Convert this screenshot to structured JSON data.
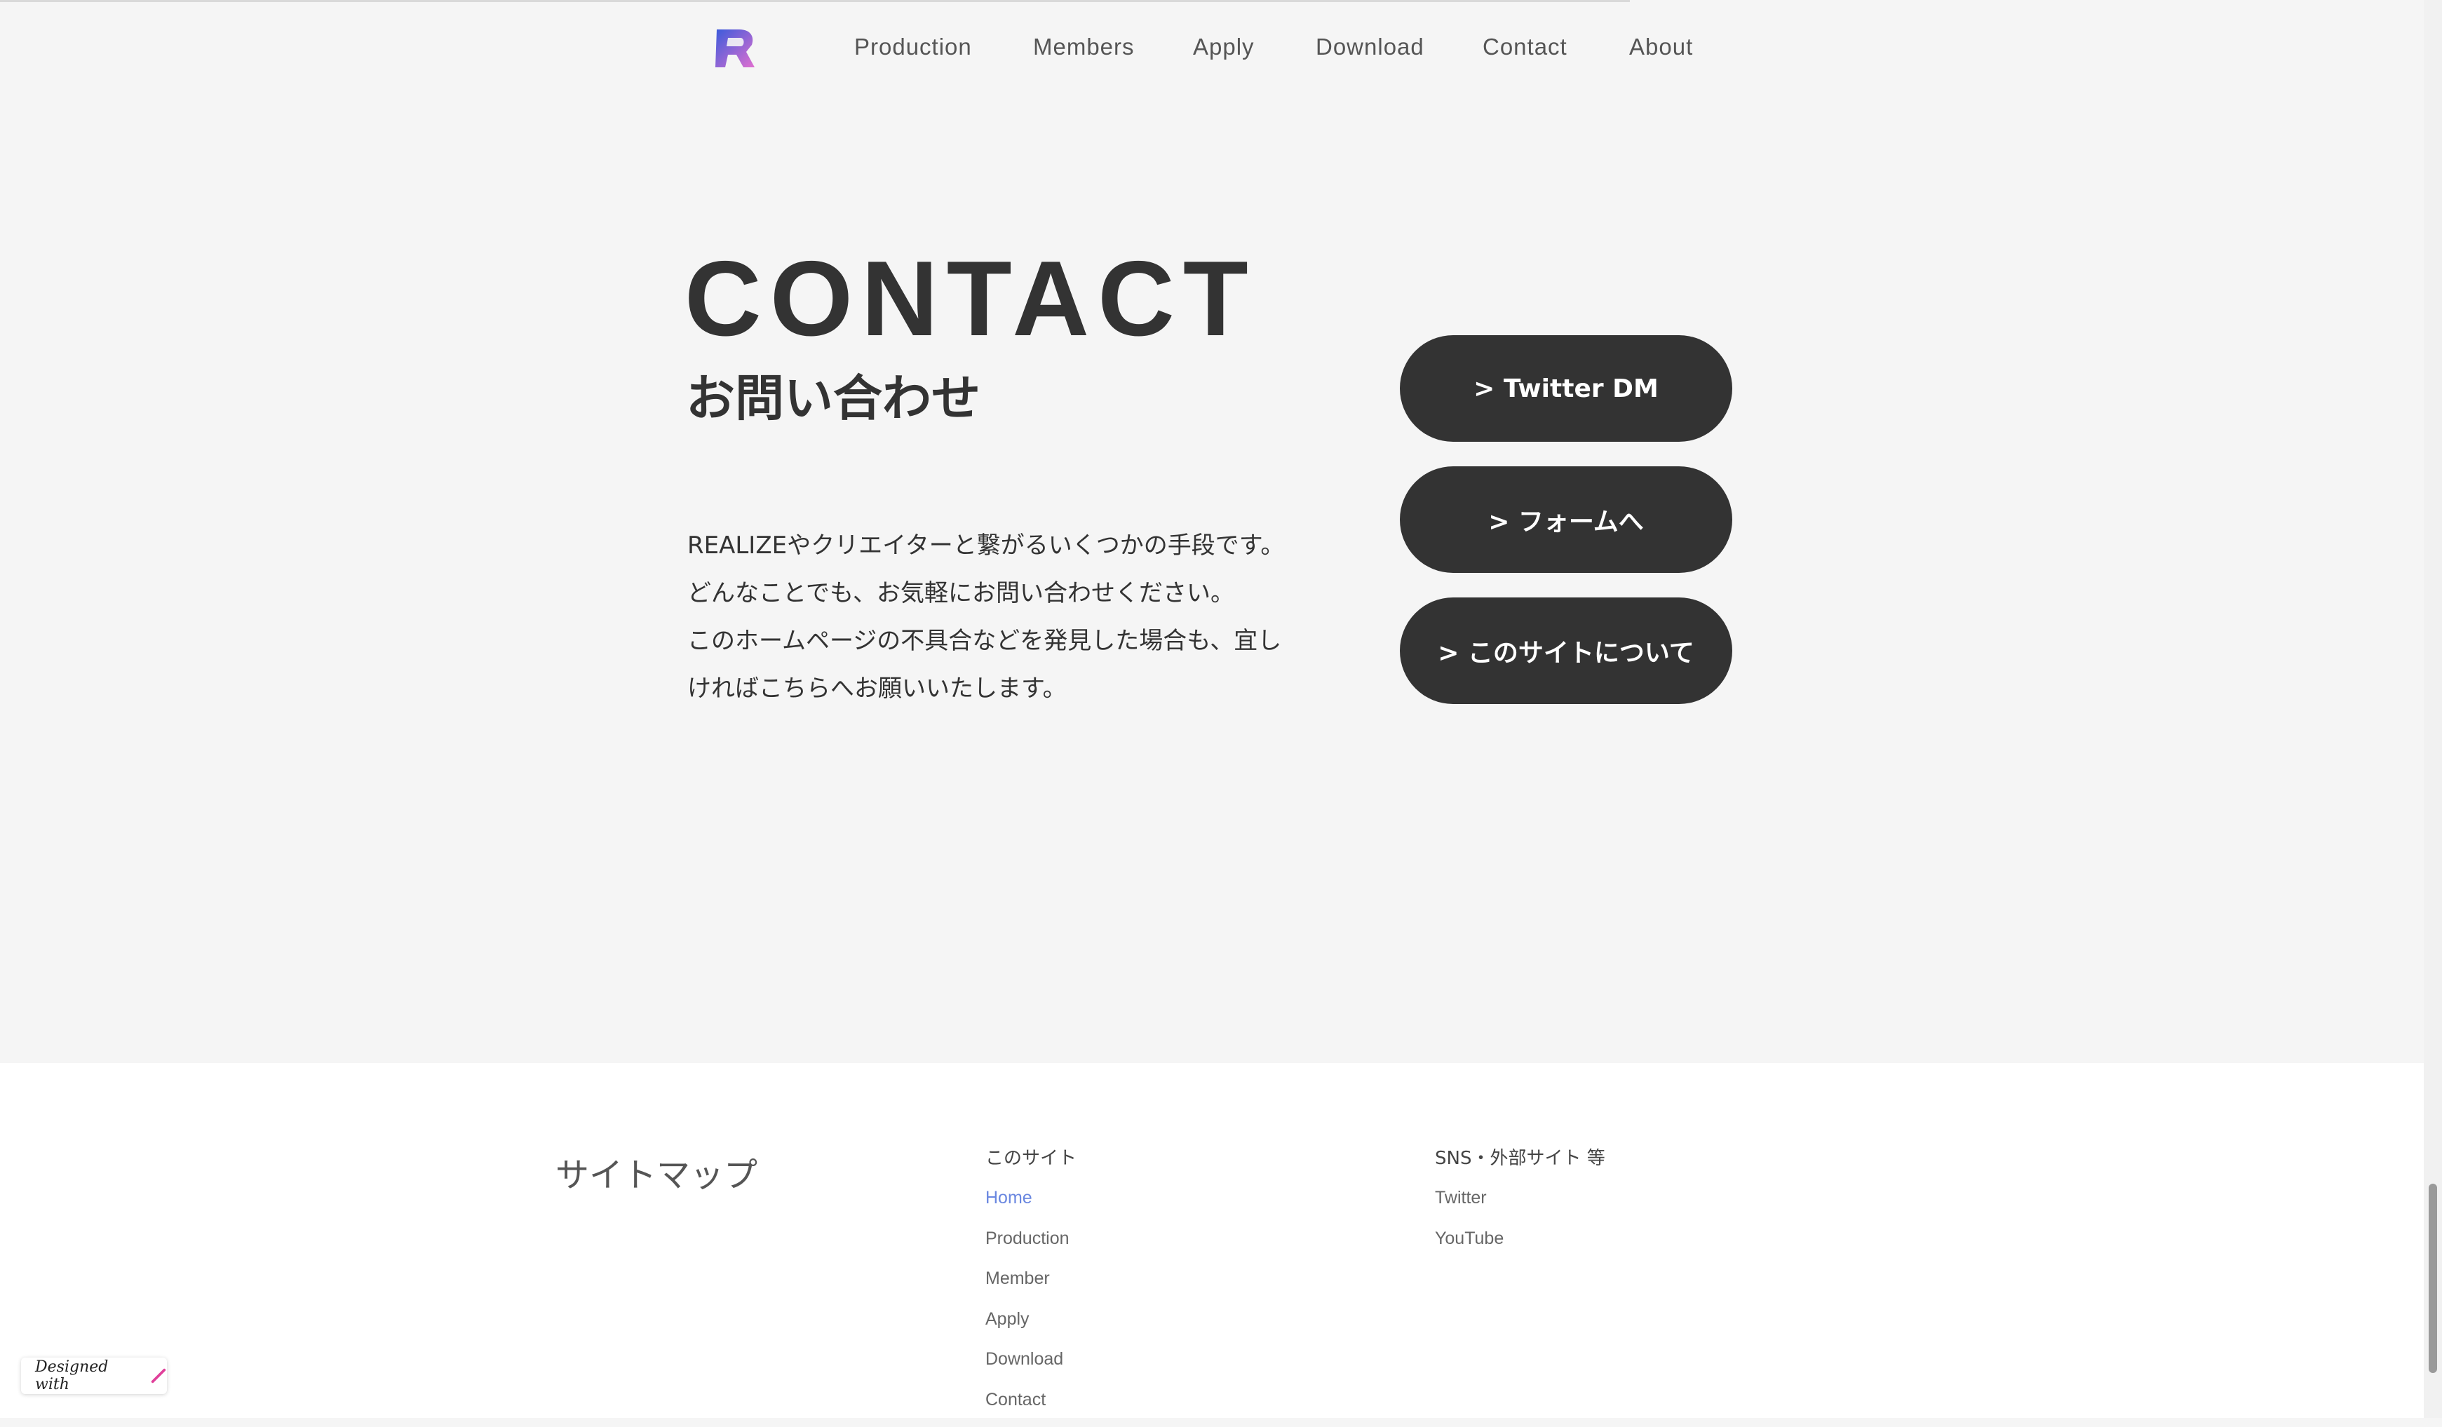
{
  "brand": {
    "logo_icon": "realize-r-logo-icon",
    "colors": {
      "accent": "#3b5bdb",
      "secondary": "#d966d6"
    }
  },
  "nav": {
    "items": [
      "Production",
      "Members",
      "Apply",
      "Download",
      "Contact",
      "About"
    ]
  },
  "hero": {
    "title": "CONTACT",
    "subtitle": "お問い合わせ",
    "description": [
      "REALIZEやクリエイターと繋がるいくつかの手段です。",
      "どんなことでも、お気軽にお問い合わせください。",
      "このホームページの不具合などを発見した場合も、宜し",
      "ければこちらへお願いいたします。"
    ]
  },
  "buttons": [
    "> Twitter DM",
    "> フォームへ",
    "> このサイトについて"
  ],
  "footer": {
    "sitemap_title": "サイトマップ",
    "site_column": {
      "heading": "このサイト",
      "links": [
        "Home",
        "Production",
        "Member",
        "Apply",
        "Download",
        "Contact"
      ],
      "active": "Home"
    },
    "sns_column": {
      "heading": "SNS・外部サイト 等",
      "links": [
        "Twitter",
        "YouTube"
      ]
    }
  },
  "badge": {
    "label": "Designed with",
    "icon": "pen-icon"
  }
}
